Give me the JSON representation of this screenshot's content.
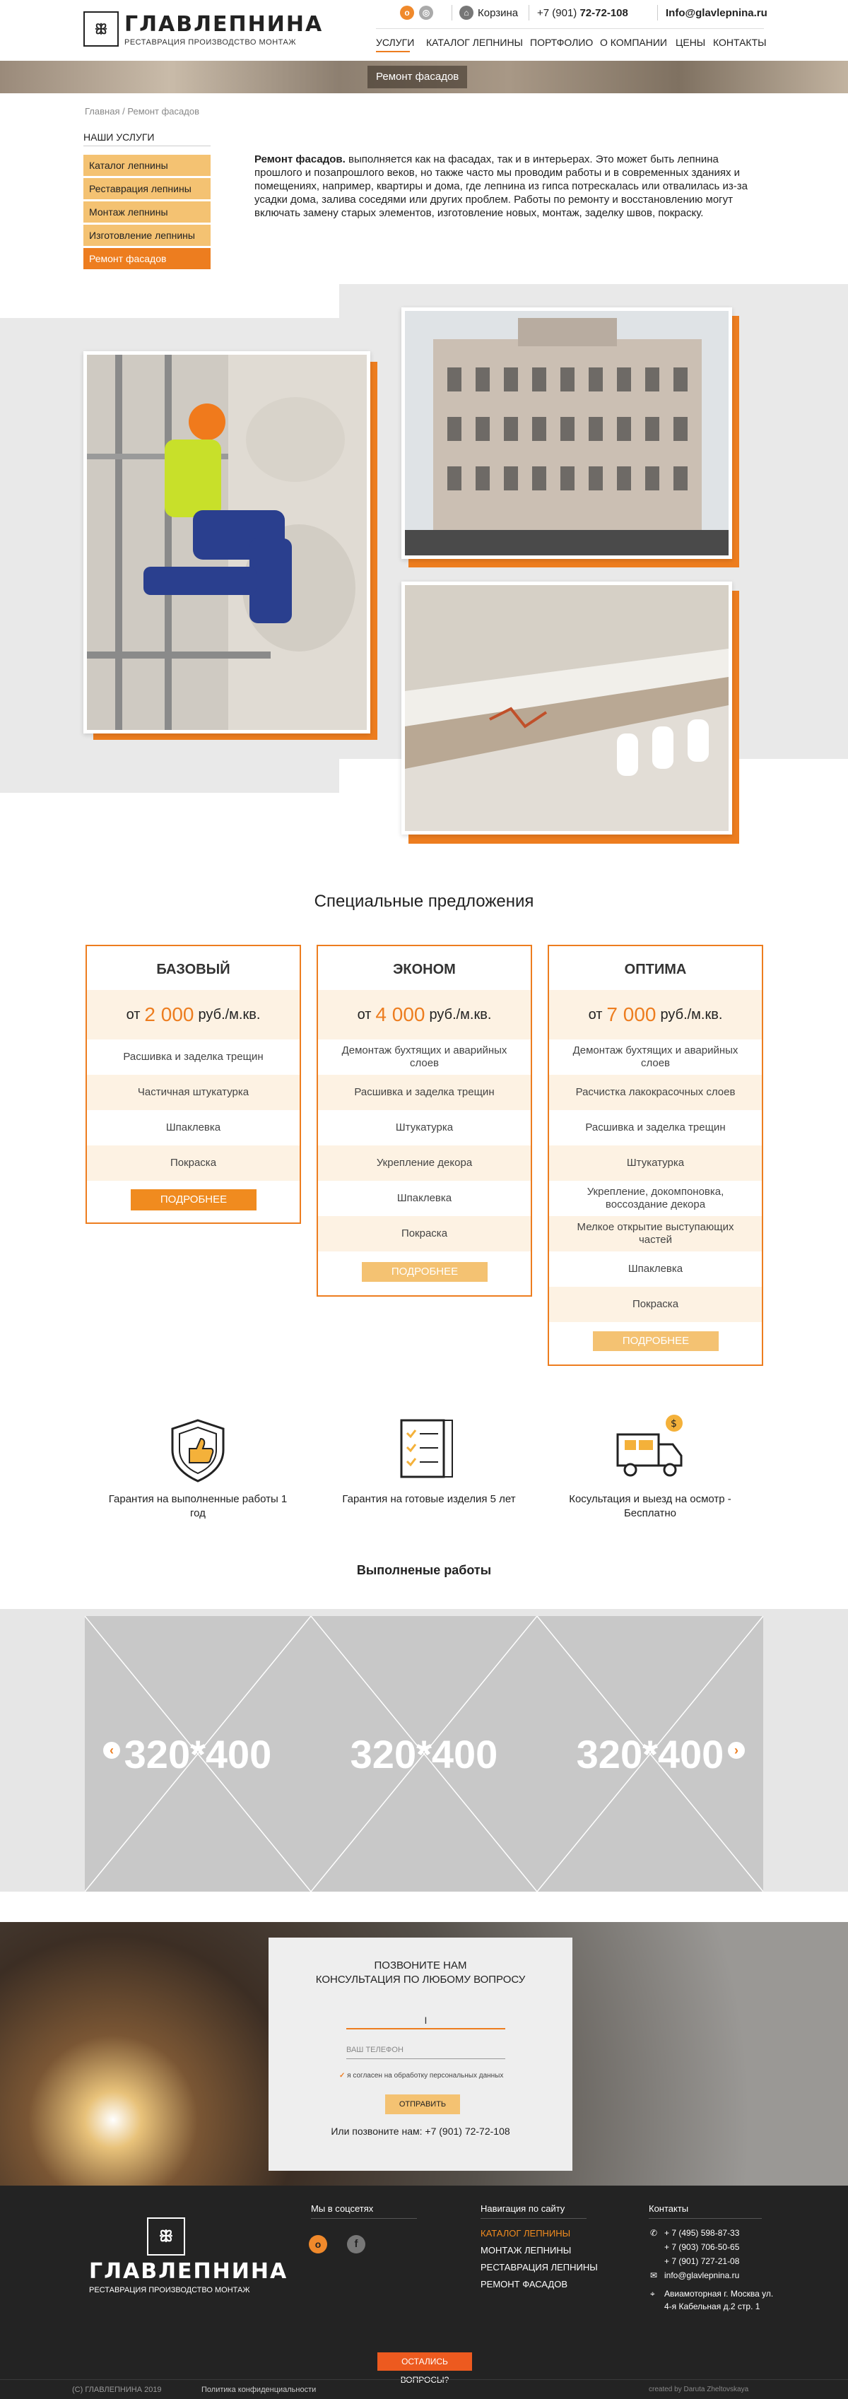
{
  "header": {
    "logo_name": "ГЛАВЛЕПНИНА",
    "logo_sub": "РЕСТАВРАЦИЯ ПРОИЗВОДСТВО МОНТАЖ",
    "cart": "Корзина",
    "phone_prefix": "+7 (901)",
    "phone_main": "72-72-108",
    "email": "Info@glavlepnina.ru",
    "nav": [
      "УСЛУГИ",
      "КАТАЛОГ ЛЕПНИНЫ",
      "ПОРТФОЛИО",
      "О КОМПАНИИ",
      "ЦЕНЫ",
      "КОНТАКТЫ"
    ]
  },
  "banner": {
    "label": "Ремонт фасадов"
  },
  "breadcrumb": {
    "home": "Главная",
    "sep": "/",
    "current": "Ремонт фасадов"
  },
  "sidebar": {
    "title": "НАШИ УСЛУГИ",
    "items": [
      "Каталог лепнины",
      "Реставрация лепнины",
      "Монтаж лепнины",
      "Изготовление лепнины",
      "Ремонт фасадов"
    ]
  },
  "intro": {
    "lead": "Ремонт фасадов.",
    "text": " выполняется как на фасадах, так и в интерьерах. Это может быть лепнина прошлого и позапрошлого веков, но также часто мы проводим работы и в современных зданиях и помещениях, например, квартиры и дома, где лепнина из гипса потрескалась или отвалилась из-за усадки дома, залива соседями или других проблем. Работы по ремонту и восстановлению могут включать замену старых элементов, изготовление новых, монтаж, заделку швов, покраску."
  },
  "offers": {
    "title": "Специальные предложения",
    "price_prefix": "от",
    "price_unit": "руб./м.кв.",
    "more_label": "ПОДРОБНЕЕ",
    "cards": [
      {
        "title": "БАЗОВЫЙ",
        "price": "2 000",
        "rows": [
          "Расшивка и заделка трещин",
          "Частичная штукатурка",
          "Шпаклевка",
          "Покраска"
        ]
      },
      {
        "title": "ЭКОНОМ",
        "price": "4 000",
        "rows": [
          "Демонтаж бухтящих и аварийных слоев",
          "Расшивка и заделка трещин",
          "Штукатурка",
          "Укрепление декора",
          "Шпаклевка",
          "Покраска"
        ]
      },
      {
        "title": "ОПТИМА",
        "price": "7 000",
        "rows": [
          "Демонтаж бухтящих и аварийных слоев",
          "Расчистка лакокрасочных слоев",
          "Расшивка и заделка трещин",
          "Штукатурка",
          "Укрепление, докомпоновка, воссоздание декора",
          "Мелкое открытие выступающих частей",
          "Шпаклевка",
          "Покраска"
        ]
      }
    ]
  },
  "features": [
    {
      "icon": "shield-thumb-icon",
      "text": "Гарантия на выполненные работы 1 год"
    },
    {
      "icon": "document-checklist-icon",
      "text": "Гарантия на готовые изделия 5 лет"
    },
    {
      "icon": "delivery-truck-icon",
      "text": "Косультация и выезд на осмотр - Бесплатно"
    }
  ],
  "works": {
    "title": "Выполненые работы",
    "placeholders": [
      "320*400",
      "320*400",
      "320*400"
    ]
  },
  "callback": {
    "title_line1": "ПОЗВОНИТЕ НАМ",
    "title_line2": "КОНСУЛЬТАЦИЯ ПО ЛЮБОМУ ВОПРОСУ",
    "name_value": "I",
    "phone_placeholder": "ВАШ ТЕЛЕФОН",
    "consent": "я согласен на обработку персональных данных",
    "submit": "ОТПРАВИТЬ",
    "call_text": "Или позвоните нам:",
    "call_phone": "+7 (901) 72-72-108"
  },
  "footer": {
    "logo_name": "ГЛАВЛЕПНИНА",
    "logo_sub": "РЕСТАВРАЦИЯ ПРОИЗВОДСТВО МОНТАЖ",
    "social_title": "Мы в соцсетях",
    "nav_title": "Навигация по сайту",
    "nav_items": [
      "КАТАЛОГ ЛЕПНИНЫ",
      "МОНТАЖ ЛЕПНИНЫ",
      "РЕСТАВРАЦИЯ ЛЕПНИНЫ",
      "РЕМОНТ ФАСАДОВ"
    ],
    "contacts_title": "Контакты",
    "phones": [
      "+ 7 (495) 598-87-33",
      "+ 7 (903) 706-50-65",
      "+ 7 (901) 727-21-08"
    ],
    "email": "info@glavlepnina.ru",
    "address_line1": "Авиамоторная г. Москва ул.",
    "address_line2": "4-я Кабельная д.2 стр. 1",
    "question_button": "ОСТАЛИСЬ ВОПРОСЫ?",
    "copyright": "(С) ГЛАВЛЕПНИНА 2019",
    "privacy": "Политика конфиденциальности",
    "created_by": "created by Daruta Zheltovskaya"
  },
  "colors": {
    "accent": "#ed7d1f",
    "beige": "#f4c272",
    "footer_bg": "#232323"
  }
}
